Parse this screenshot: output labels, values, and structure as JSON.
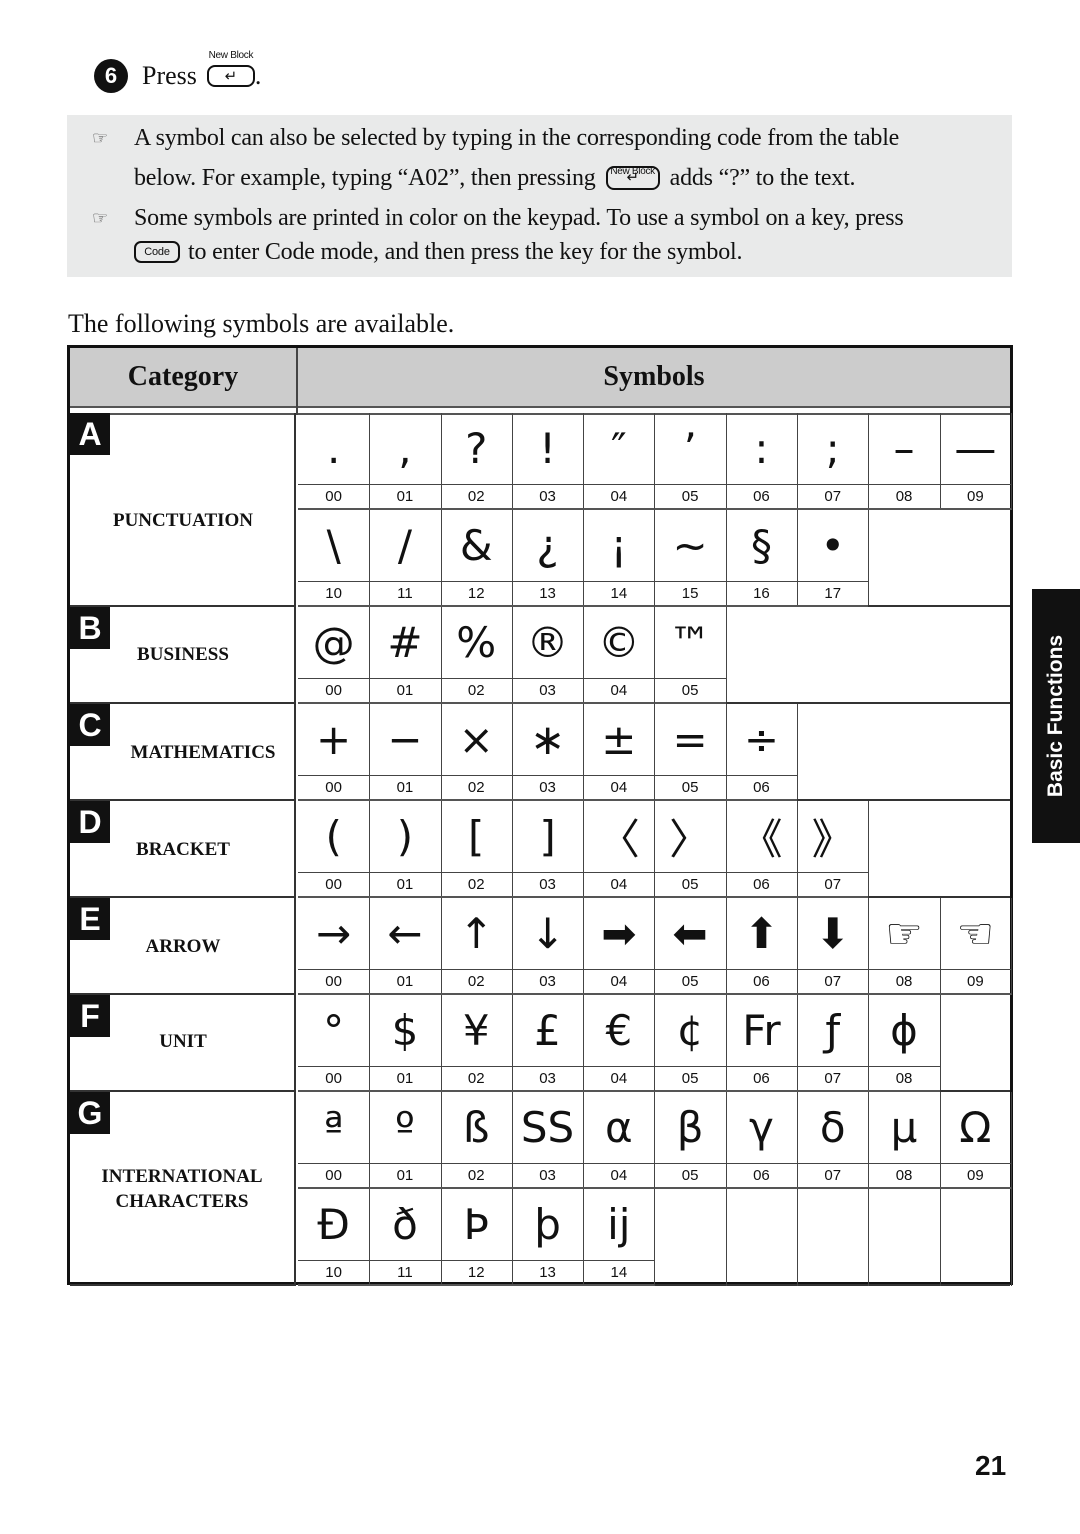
{
  "step": {
    "number": "6",
    "text": "Press",
    "key_caption": "New Block",
    "key_glyph": "↵",
    "suffix": "."
  },
  "notes": [
    {
      "icon": "pointing-hand-icon",
      "glyph": "☞",
      "lines": [
        "A symbol can also be selected by typing in the corresponding code from the table"
      ]
    },
    {
      "line2_before": "below. For example, typing “A02”, then pressing",
      "key_caption": "New Block",
      "key_glyph": "↵",
      "line2_after": "adds “?” to the text."
    },
    {
      "icon": "pointing-hand-icon",
      "glyph": "☞",
      "lines": [
        "Some symbols are printed in color on the keypad. To use a symbol on a key, press"
      ]
    },
    {
      "key_label": "Code",
      "line_after": "to enter Code mode, and then press the key for the symbol."
    }
  ],
  "intro": "The following symbols are available.",
  "table": {
    "header_category": "Category",
    "header_symbols": "Symbols",
    "categories": [
      {
        "letter": "A",
        "name": "PUNCTUATION",
        "rows": [
          {
            "symbols": [
              ".",
              ",",
              "?",
              "!",
              "″",
              "’",
              ":",
              ";",
              "–",
              "—"
            ],
            "codes": [
              "00",
              "01",
              "02",
              "03",
              "04",
              "05",
              "06",
              "07",
              "08",
              "09"
            ]
          },
          {
            "symbols": [
              "\\",
              "/",
              "&",
              "¿",
              "¡",
              "~",
              "§",
              "•"
            ],
            "codes": [
              "10",
              "11",
              "12",
              "13",
              "14",
              "15",
              "16",
              "17"
            ]
          }
        ]
      },
      {
        "letter": "B",
        "name": "BUSINESS",
        "rows": [
          {
            "symbols": [
              "@",
              "#",
              "%",
              "®",
              "©",
              "™"
            ],
            "codes": [
              "00",
              "01",
              "02",
              "03",
              "04",
              "05"
            ]
          }
        ]
      },
      {
        "letter": "C",
        "name": "MATHEMATICS",
        "rows": [
          {
            "symbols": [
              "+",
              "−",
              "×",
              "∗",
              "±",
              "=",
              "÷"
            ],
            "codes": [
              "00",
              "01",
              "02",
              "03",
              "04",
              "05",
              "06"
            ]
          }
        ]
      },
      {
        "letter": "D",
        "name": "BRACKET",
        "rows": [
          {
            "symbols": [
              "(",
              ")",
              "[",
              "]",
              "〈",
              "〉",
              "《",
              "》"
            ],
            "codes": [
              "00",
              "01",
              "02",
              "03",
              "04",
              "05",
              "06",
              "07"
            ]
          }
        ]
      },
      {
        "letter": "E",
        "name": "ARROW",
        "rows": [
          {
            "symbols": [
              "→",
              "←",
              "↑",
              "↓",
              "➡",
              "⬅",
              "⬆",
              "⬇",
              "☞",
              "☜"
            ],
            "codes": [
              "00",
              "01",
              "02",
              "03",
              "04",
              "05",
              "06",
              "07",
              "08",
              "09"
            ]
          }
        ]
      },
      {
        "letter": "F",
        "name": "UNIT",
        "rows": [
          {
            "symbols": [
              "°",
              "$",
              "¥",
              "£",
              "€",
              "¢",
              "Fr",
              "ƒ",
              "ϕ"
            ],
            "codes": [
              "00",
              "01",
              "02",
              "03",
              "04",
              "05",
              "06",
              "07",
              "08"
            ]
          }
        ]
      },
      {
        "letter": "G",
        "name": "INTERNATIONAL CHARACTERS",
        "rows": [
          {
            "symbols": [
              "ª",
              "º",
              "ß",
              "SS",
              "α",
              "β",
              "γ",
              "δ",
              "μ",
              "Ω"
            ],
            "codes": [
              "00",
              "01",
              "02",
              "03",
              "04",
              "05",
              "06",
              "07",
              "08",
              "09"
            ]
          },
          {
            "symbols": [
              "Đ",
              "ð",
              "Þ",
              "þ",
              "ĳ"
            ],
            "codes": [
              "10",
              "11",
              "12",
              "13",
              "14"
            ]
          }
        ]
      }
    ]
  },
  "side_tab": "Basic Functions",
  "page_number": "21"
}
